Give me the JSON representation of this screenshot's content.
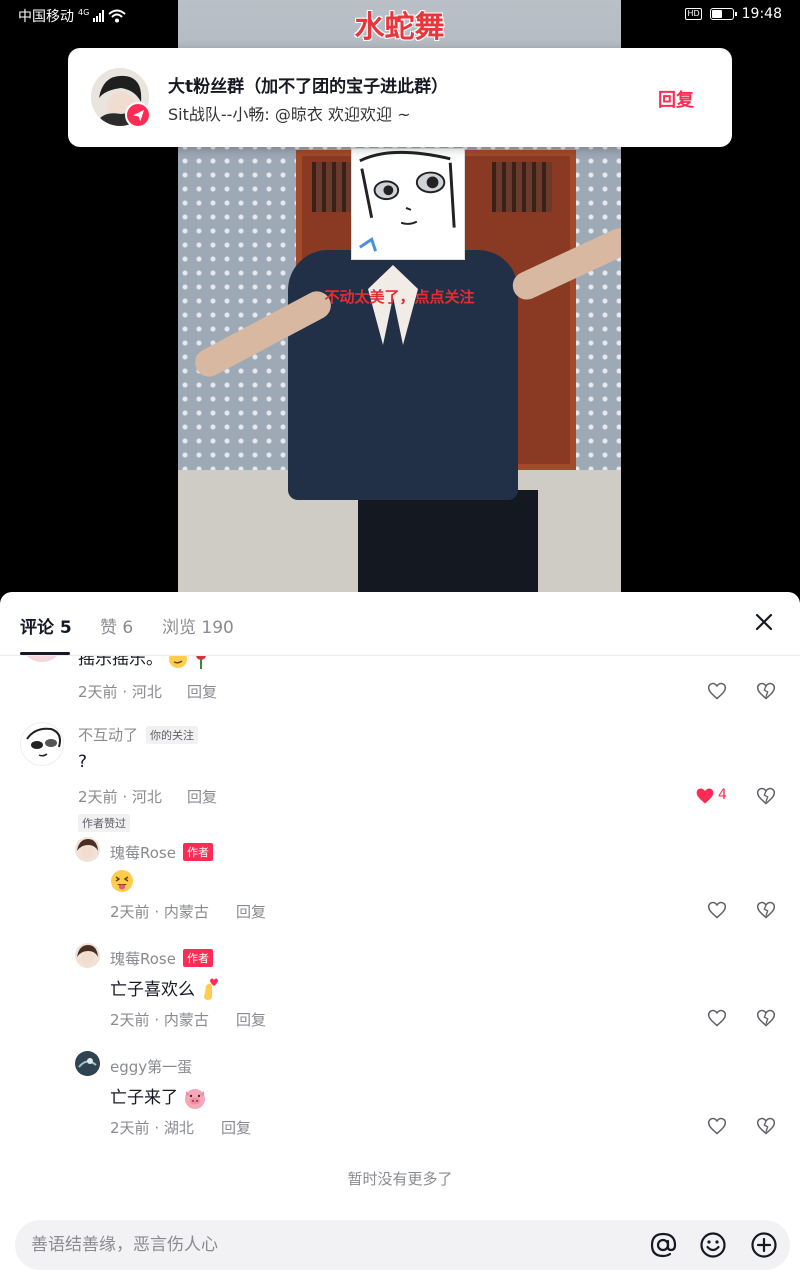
{
  "status_bar": {
    "carrier": "中国移动",
    "network": "4G",
    "time": "19:48",
    "hd": "HD",
    "battery_level": 0.55,
    "icons": [
      "signal-icon",
      "wifi-icon",
      "hd-icon",
      "battery-icon"
    ]
  },
  "video": {
    "title": "水蛇舞",
    "caption": "不动太美了，点点关注"
  },
  "notification": {
    "title": "大t粉丝群（加不了团的宝子进此群）",
    "message": "Sit战队--小畅: @晾衣 欢迎欢迎 ~",
    "reply_label": "回复",
    "accent": "#fe2c55"
  },
  "tabs": [
    {
      "label": "评论",
      "count": "5",
      "active": true
    },
    {
      "label": "赞",
      "count": "6",
      "active": false
    },
    {
      "label": "浏览",
      "count": "190",
      "active": false
    }
  ],
  "comments": [
    {
      "text": "摇乐摇乐。",
      "time": "2天前",
      "location": "河北",
      "reply_label": "回复"
    },
    {
      "name": "不互动了",
      "follow_tag": "你的关注",
      "text": "?",
      "time": "2天前",
      "location": "河北",
      "reply_label": "回复",
      "likes": "4",
      "liked": true,
      "badge": "作者赞过",
      "replies": [
        {
          "name": "瑰莓Rose",
          "author_tag": "作者",
          "text": "",
          "emoji": "squinting-tongue-emoji",
          "time": "2天前",
          "location": "内蒙古",
          "reply_label": "回复"
        },
        {
          "name": "瑰莓Rose",
          "author_tag": "作者",
          "text": "亡子喜欢么",
          "emoji": "finger-heart-emoji",
          "time": "2天前",
          "location": "内蒙古",
          "reply_label": "回复"
        },
        {
          "name": "eggy第一蛋",
          "text": "亡子来了",
          "emoji": "pig-face-emoji",
          "time": "2天前",
          "location": "湖北",
          "reply_label": "回复"
        }
      ]
    }
  ],
  "no_more": "暂时没有更多了",
  "input": {
    "placeholder": "善语结善缘，恶言伤人心",
    "icons": [
      "at-icon",
      "emoji-icon",
      "plus-icon"
    ]
  },
  "separator": " · "
}
